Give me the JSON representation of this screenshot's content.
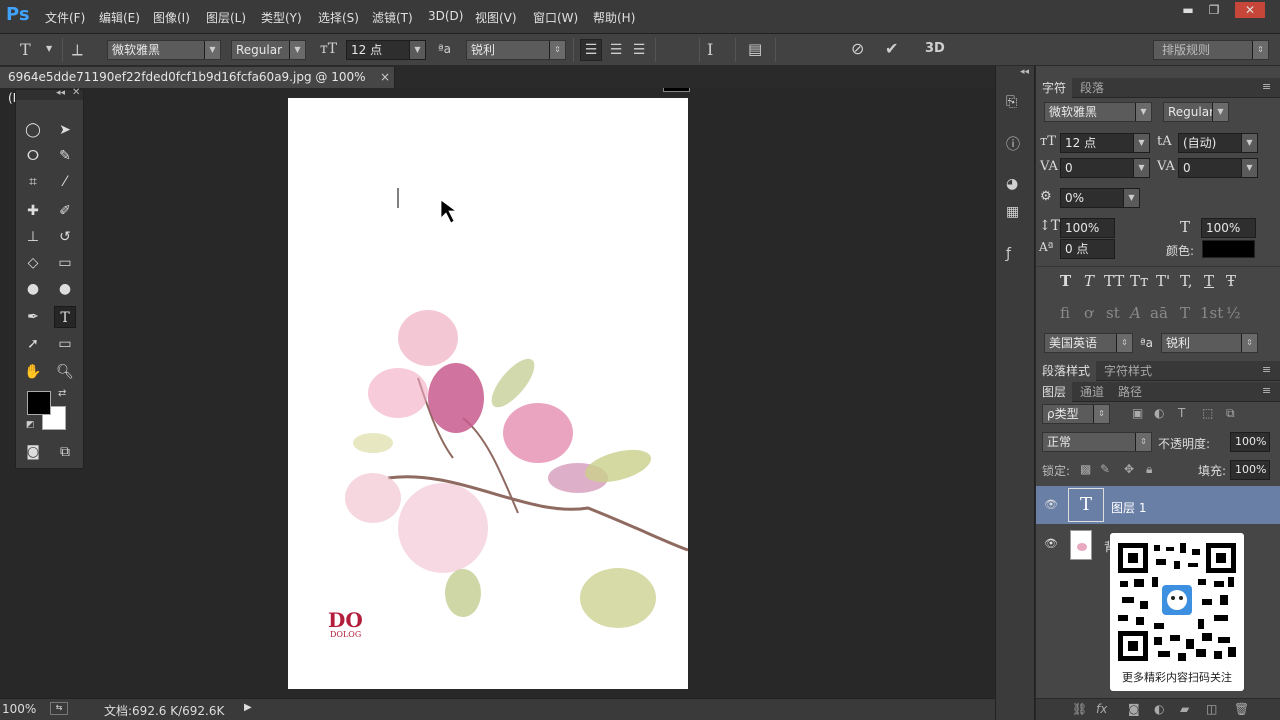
{
  "app": {
    "logo": "Ps"
  },
  "menu": [
    "文件(F)",
    "编辑(E)",
    "图像(I)",
    "图层(L)",
    "类型(Y)",
    "选择(S)",
    "滤镜(T)",
    "3D(D)",
    "视图(V)",
    "窗口(W)",
    "帮助(H)"
  ],
  "window_controls": {
    "minimize": "▬",
    "maximize": "❐",
    "close": "✕"
  },
  "options": {
    "font_family": "微软雅黑",
    "font_style": "Regular",
    "font_size": "12 点",
    "aa_label": "ªa",
    "antialias": "锐利",
    "color": "#000000",
    "threed": "3D",
    "typesetting": "排版规则"
  },
  "document": {
    "tab_title": "6964e5dde71190ef22fded0fcf1b9d16fcfa60a9.jpg @ 100%(RGB/8)",
    "close": "×"
  },
  "canvas_logo": {
    "line1": "DO",
    "line2": "DOLOG"
  },
  "status": {
    "zoom": "100%",
    "doc_info": "文档:692.6 K/692.6K"
  },
  "character_panel": {
    "tabs": [
      "字符",
      "段落"
    ],
    "font_family": "微软雅黑",
    "font_style": "Regular",
    "size": "12 点",
    "leading": "(自动)",
    "kerning": "0",
    "tracking": "0",
    "scale_pct": "0%",
    "vscale": "100%",
    "hscale": "100%",
    "baseline": "0 点",
    "color_label": "颜色:",
    "color": "#000000",
    "language": "美国英语",
    "aa_label": "ªa",
    "antialias": "锐利",
    "style_glyphs": [
      "T",
      "T",
      "TT",
      "Tт",
      "T'",
      "T,",
      "T",
      "Ŧ"
    ],
    "otf_glyphs": [
      "fi",
      "ơ",
      "st",
      "A",
      "aā",
      "T",
      "1st",
      "½"
    ]
  },
  "style_tabs": [
    "段落样式",
    "字符样式"
  ],
  "layers_panel": {
    "tabs": [
      "图层",
      "通道",
      "路径"
    ],
    "filter": "ρ类型",
    "blend_mode": "正常",
    "opacity_label": "不透明度:",
    "opacity": "100%",
    "lock_label": "锁定:",
    "fill_label": "填充:",
    "fill": "100%",
    "layers": [
      {
        "name": "图层 1",
        "thumb": "T",
        "selected": true
      },
      {
        "name": "背景",
        "thumb": "",
        "selected": false
      }
    ]
  },
  "qr_overlay": {
    "caption": "更多精彩内容扫码关注"
  }
}
